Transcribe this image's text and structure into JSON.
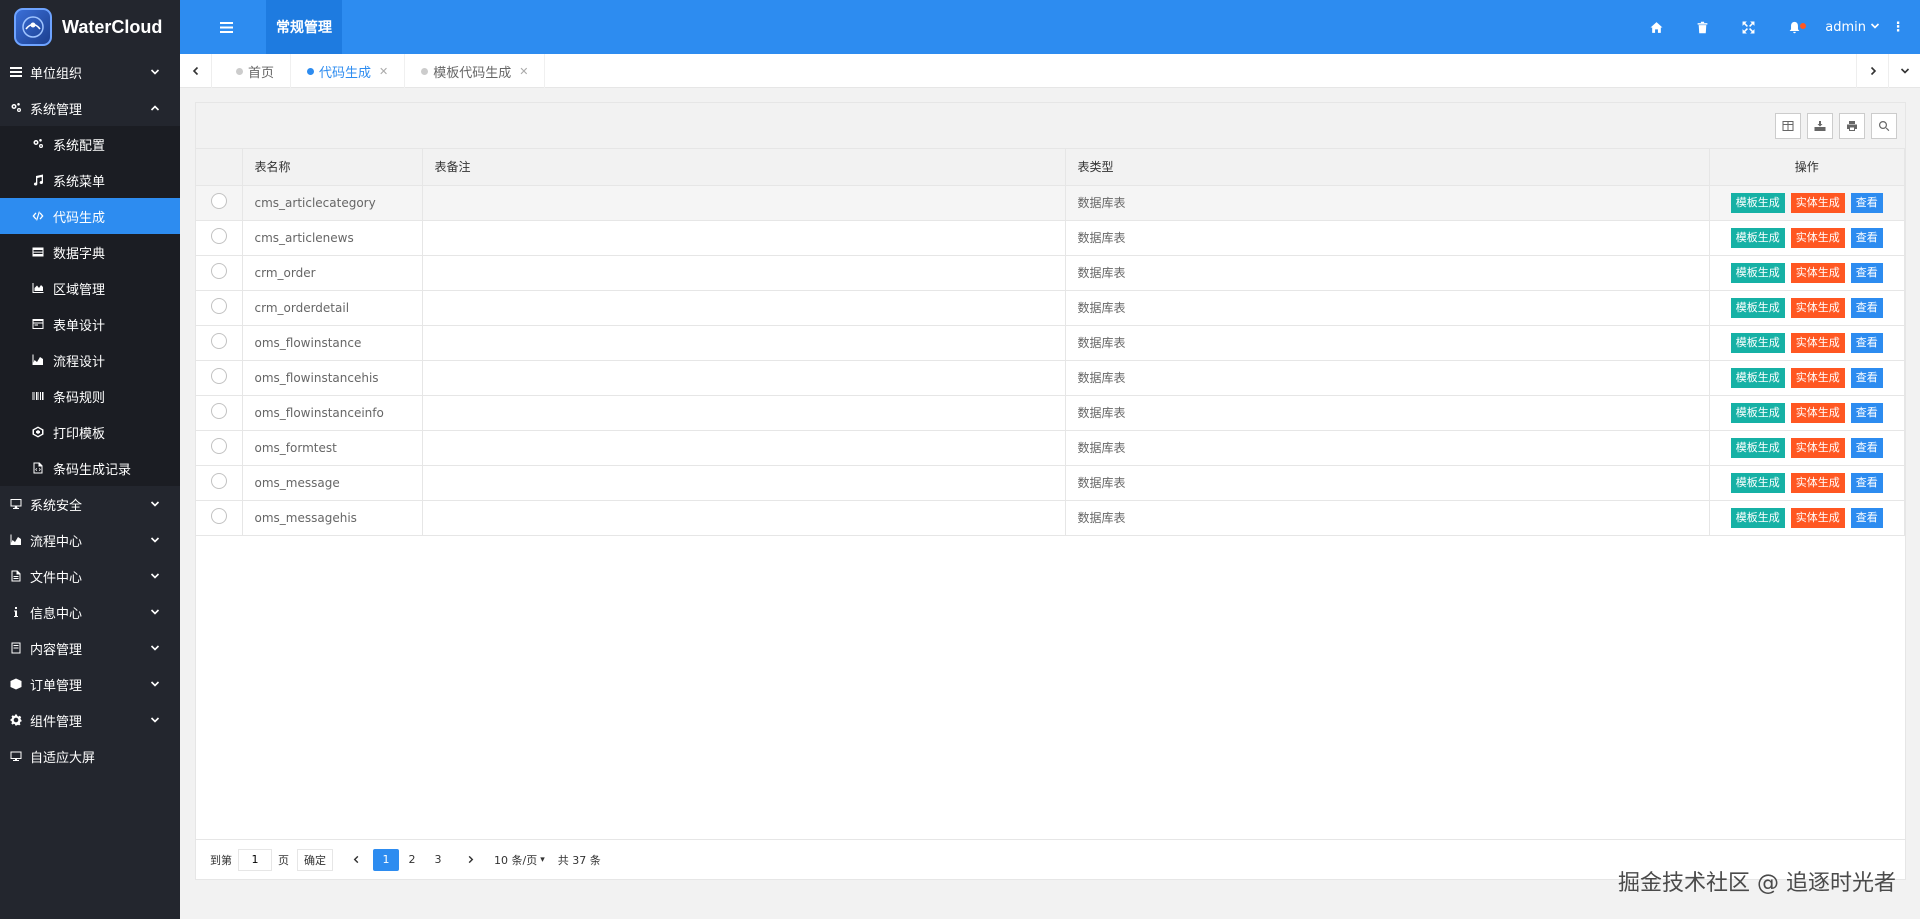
{
  "app": {
    "title": "WaterCloud"
  },
  "header": {
    "top_tab": "常规管理",
    "user": "admin"
  },
  "sidebar": {
    "groups": [
      {
        "label": "单位组织",
        "icon": "list-icon",
        "expanded": false
      },
      {
        "label": "系统管理",
        "icon": "cogs-icon",
        "expanded": true,
        "items": [
          {
            "label": "系统配置",
            "icon": "cogs-icon"
          },
          {
            "label": "系统菜单",
            "icon": "music-icon"
          },
          {
            "label": "代码生成",
            "icon": "code-icon",
            "active": true
          },
          {
            "label": "数据字典",
            "icon": "table-icon"
          },
          {
            "label": "区域管理",
            "icon": "area-chart-icon"
          },
          {
            "label": "表单设计",
            "icon": "form-icon"
          },
          {
            "label": "流程设计",
            "icon": "flow-icon"
          },
          {
            "label": "条码规则",
            "icon": "barcode-icon"
          },
          {
            "label": "打印模板",
            "icon": "print-template-icon"
          },
          {
            "label": "条码生成记录",
            "icon": "file-code-icon"
          }
        ]
      },
      {
        "label": "系统安全",
        "icon": "desktop-icon",
        "expanded": false
      },
      {
        "label": "流程中心",
        "icon": "flow-icon",
        "expanded": false
      },
      {
        "label": "文件中心",
        "icon": "file-icon",
        "expanded": false
      },
      {
        "label": "信息中心",
        "icon": "info-icon",
        "expanded": false
      },
      {
        "label": "内容管理",
        "icon": "book-icon",
        "expanded": false
      },
      {
        "label": "订单管理",
        "icon": "cube-icon",
        "expanded": false
      },
      {
        "label": "组件管理",
        "icon": "gear-icon",
        "expanded": false
      },
      {
        "label": "自适应大屏",
        "icon": "monitor-icon",
        "expanded": null
      }
    ]
  },
  "tabs": [
    {
      "label": "首页",
      "active": false,
      "closable": false
    },
    {
      "label": "代码生成",
      "active": true,
      "closable": true
    },
    {
      "label": "模板代码生成",
      "active": false,
      "closable": true
    }
  ],
  "table": {
    "headers": {
      "name": "表名称",
      "note": "表备注",
      "type": "表类型",
      "ops": "操作"
    },
    "op_labels": {
      "template": "模板生成",
      "entity": "实体生成",
      "view": "查看"
    },
    "rows": [
      {
        "name": "cms_articlecategory",
        "note": "",
        "type": "数据库表"
      },
      {
        "name": "cms_articlenews",
        "note": "",
        "type": "数据库表"
      },
      {
        "name": "crm_order",
        "note": "",
        "type": "数据库表"
      },
      {
        "name": "crm_orderdetail",
        "note": "",
        "type": "数据库表"
      },
      {
        "name": "oms_flowinstance",
        "note": "",
        "type": "数据库表"
      },
      {
        "name": "oms_flowinstancehis",
        "note": "",
        "type": "数据库表"
      },
      {
        "name": "oms_flowinstanceinfo",
        "note": "",
        "type": "数据库表"
      },
      {
        "name": "oms_formtest",
        "note": "",
        "type": "数据库表"
      },
      {
        "name": "oms_message",
        "note": "",
        "type": "数据库表"
      },
      {
        "name": "oms_messagehis",
        "note": "",
        "type": "数据库表"
      }
    ]
  },
  "pager": {
    "goto_label": "到第",
    "goto_value": "1",
    "page_suffix": "页",
    "confirm": "确定",
    "pages": [
      "1",
      "2",
      "3"
    ],
    "current": "1",
    "page_size": "10 条/页",
    "total": "共 37 条"
  },
  "watermark": "掘金技术社区 @ 追逐时光者",
  "colors": {
    "primary": "#2d8cf0",
    "sidebar_bg": "#23262e",
    "btn_template": "#16b1a5",
    "btn_entity": "#ff5722",
    "btn_view": "#2d8cf0"
  }
}
